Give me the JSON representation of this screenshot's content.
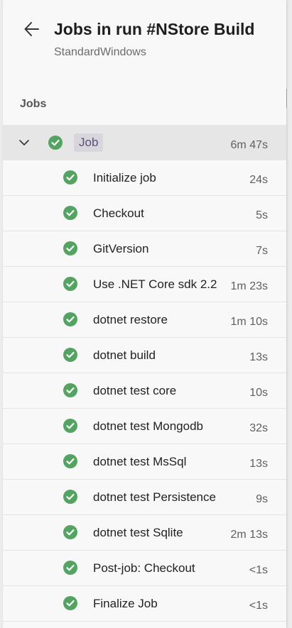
{
  "header": {
    "title": "Jobs in run #NStore Build",
    "subtitle": "StandardWindows"
  },
  "section_label": "Jobs",
  "job": {
    "name": "Job",
    "duration": "6m 47s",
    "status": "succeeded",
    "expanded": true
  },
  "steps": [
    {
      "name": "Initialize job",
      "duration": "24s"
    },
    {
      "name": "Checkout",
      "duration": "5s"
    },
    {
      "name": "GitVersion",
      "duration": "7s"
    },
    {
      "name": "Use .NET Core sdk 2.2",
      "duration": "1m 23s"
    },
    {
      "name": "dotnet restore",
      "duration": "1m 10s"
    },
    {
      "name": "dotnet build",
      "duration": "13s"
    },
    {
      "name": "dotnet test core",
      "duration": "10s"
    },
    {
      "name": "dotnet test Mongodb",
      "duration": "32s"
    },
    {
      "name": "dotnet test MsSql",
      "duration": "13s"
    },
    {
      "name": "dotnet test Persistence",
      "duration": "9s"
    },
    {
      "name": "dotnet test Sqlite",
      "duration": "2m 13s"
    },
    {
      "name": "Post-job: Checkout",
      "duration": "<1s"
    },
    {
      "name": "Finalize Job",
      "duration": "<1s"
    }
  ],
  "colors": {
    "success": "#55a362",
    "panel_bg": "#f8f8f8",
    "selected_row": "#e6e6e6"
  },
  "icons": {
    "back": "arrow-left-icon",
    "expand": "chevron-down-icon",
    "status": "success-check-icon"
  }
}
